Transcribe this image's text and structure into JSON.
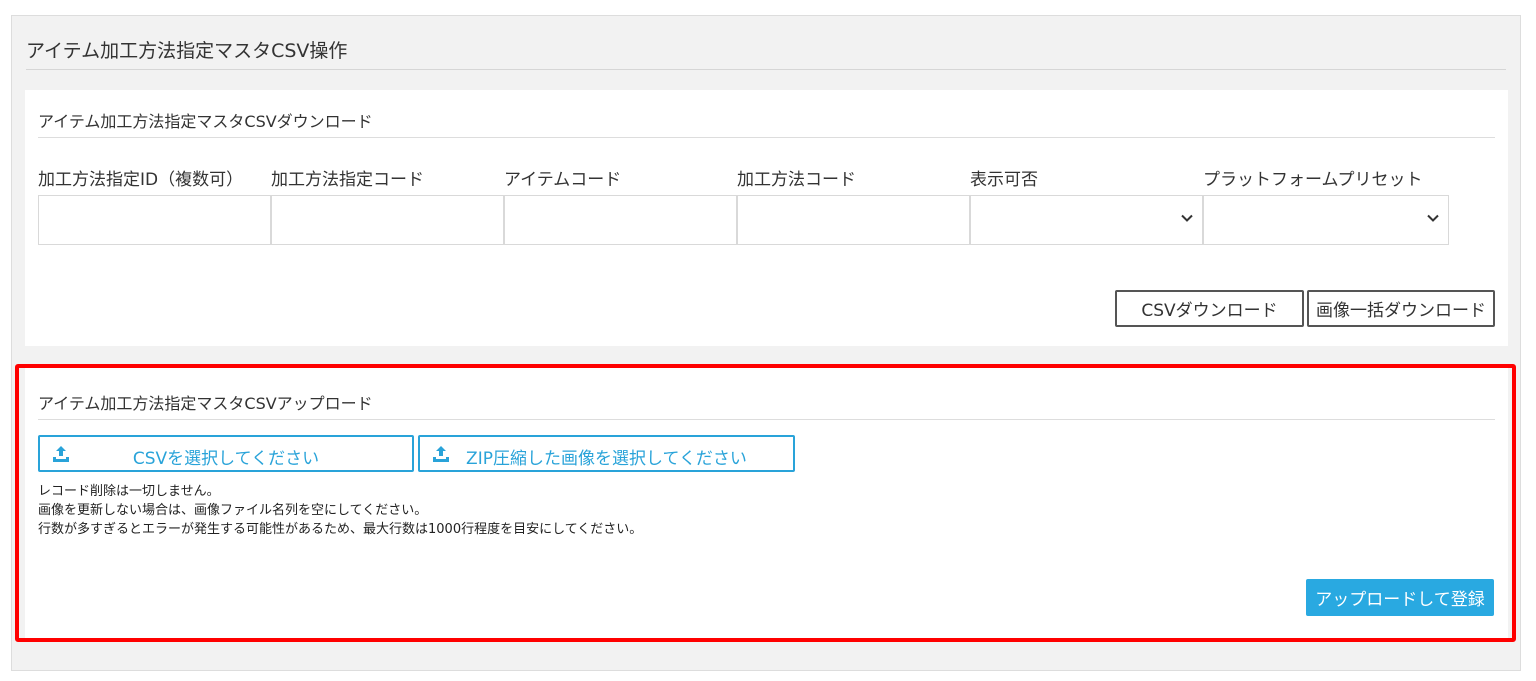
{
  "page_title": "アイテム加工方法指定マスタCSV操作",
  "download": {
    "title": "アイテム加工方法指定マスタCSVダウンロード",
    "fields": [
      {
        "label": "加工方法指定ID（複数可）",
        "type": "text",
        "value": ""
      },
      {
        "label": "加工方法指定コード",
        "type": "text",
        "value": ""
      },
      {
        "label": "アイテムコード",
        "type": "text",
        "value": ""
      },
      {
        "label": "加工方法コード",
        "type": "text",
        "value": ""
      },
      {
        "label": "表示可否",
        "type": "select",
        "value": ""
      },
      {
        "label": "プラットフォームプリセット",
        "type": "select",
        "value": ""
      }
    ],
    "csv_button": "CSVダウンロード",
    "images_button": "画像一括ダウンロード"
  },
  "upload": {
    "title": "アイテム加工方法指定マスタCSVアップロード",
    "csv_select_button": "CSVを選択してください",
    "zip_select_button": "ZIP圧縮した画像を選択してください",
    "notes": [
      "レコード削除は一切しません。",
      "画像を更新しない場合は、画像ファイル名列を空にしてください。",
      "行数が多すぎるとエラーが発生する可能性があるため、最大行数は1000行程度を目安にしてください。"
    ],
    "submit_button": "アップロードして登録"
  },
  "colors": {
    "accent": "#29a9e1",
    "highlight": "#ff0000"
  }
}
